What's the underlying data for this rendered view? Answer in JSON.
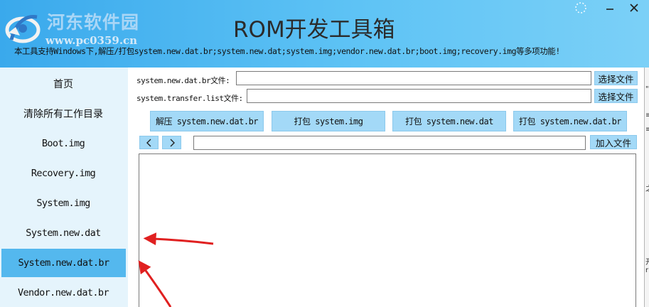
{
  "header": {
    "watermark_title": "河东软件园",
    "watermark_url": "www.pc0359.cn",
    "app_title": "ROM开发工具箱",
    "subtitle": "本工具支持Windows下,解压/打包system.new.dat.br;system.new.dat;system.img;vendor.new.dat.br;boot.img;recovery.img等多项功能!",
    "window_controls": [
      "loading-icon",
      "minimize-icon",
      "close-icon"
    ]
  },
  "sidebar": {
    "items": [
      {
        "label": "首页"
      },
      {
        "label": "清除所有工作目录"
      },
      {
        "label": "Boot.img"
      },
      {
        "label": "Recovery.img"
      },
      {
        "label": "System.img"
      },
      {
        "label": "System.new.dat"
      },
      {
        "label": "System.new.dat.br",
        "selected": true
      },
      {
        "label": "Vendor.new.dat.br"
      }
    ]
  },
  "main": {
    "file_rows": [
      {
        "label": "system.new.dat.br文件:",
        "value": "",
        "button": "选择文件"
      },
      {
        "label": "system.transfer.list文件:",
        "value": "",
        "button": "选择文件"
      }
    ],
    "action_buttons": [
      {
        "label": "解压 system.new.dat.br"
      },
      {
        "label": "打包 system.img"
      },
      {
        "label": "打包 system.new.dat"
      },
      {
        "label": "打包 system.new.dat.br"
      }
    ],
    "nav": {
      "prev_icon": "chevron-left-icon",
      "next_icon": "chevron-right-icon"
    },
    "path_input": {
      "value": ""
    },
    "add_file_label": "加入文件",
    "output_text": ""
  },
  "background_window": {
    "fragments": [
      "l",
      "\"",
      "≡",
      "≡",
      "之",
      "开",
      "r"
    ]
  },
  "colors": {
    "header_start": "#3aa9ec",
    "header_end": "#7bd0f7",
    "sidebar_bg": "#e5f4fc",
    "sidebar_selected": "#54b8ee",
    "button_bg": "#a3d9f7",
    "annotation_arrow": "#e02020"
  }
}
